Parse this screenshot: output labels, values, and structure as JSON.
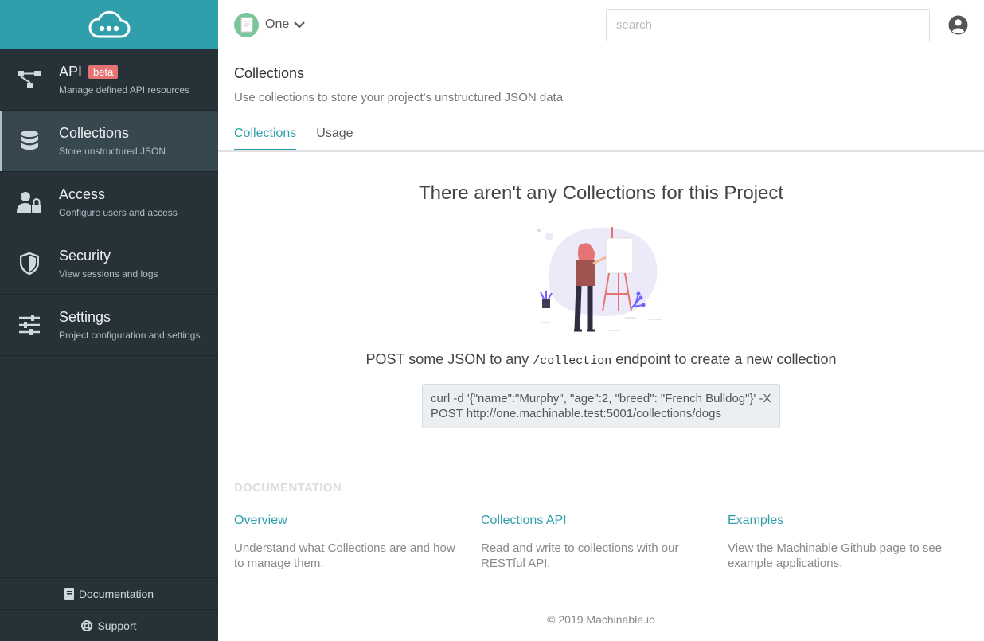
{
  "sidebar": {
    "logo_icon": "cloud-chat-icon",
    "items": [
      {
        "title": "API",
        "badge": "beta",
        "subtitle": "Manage defined API resources",
        "icon": "api-tree-icon"
      },
      {
        "title": "Collections",
        "subtitle": "Store unstructured JSON",
        "icon": "database-icon"
      },
      {
        "title": "Access",
        "subtitle": "Configure users and access",
        "icon": "user-lock-icon"
      },
      {
        "title": "Security",
        "subtitle": "View sessions and logs",
        "icon": "shield-icon"
      },
      {
        "title": "Settings",
        "subtitle": "Project configuration and settings",
        "icon": "sliders-icon"
      }
    ],
    "footer": {
      "documentation_label": "Documentation",
      "support_label": "Support"
    }
  },
  "topbar": {
    "project_name": "One",
    "search_placeholder": "search"
  },
  "page": {
    "title": "Collections",
    "description": "Use collections to store your project's unstructured JSON data",
    "tabs": [
      {
        "label": "Collections"
      },
      {
        "label": "Usage"
      }
    ]
  },
  "empty_state": {
    "title": "There aren't any Collections for this Project",
    "instruction_before": "POST some JSON to any ",
    "instruction_code": "/collection",
    "instruction_after": " endpoint to create a new collection",
    "curl_line1": "curl -d '{\"name\":\"Murphy\", \"age\":2, \"breed\": \"French Bulldog\"}' -X",
    "curl_line2": "POST http://one.machinable.test:5001/collections/dogs"
  },
  "documentation": {
    "heading": "DOCUMENTATION",
    "items": [
      {
        "title": "Overview",
        "description": "Understand what Collections are and how to manage them."
      },
      {
        "title": "Collections API",
        "description": "Read and write to collections with our RESTful API."
      },
      {
        "title": "Examples",
        "description": "View the Machinable Github page to see example applications."
      }
    ]
  },
  "footer": {
    "copyright": "© 2019 Machinable.io"
  },
  "colors": {
    "accent": "#2e9fab",
    "sidebar_bg": "#263238",
    "badge": "#e57373"
  }
}
